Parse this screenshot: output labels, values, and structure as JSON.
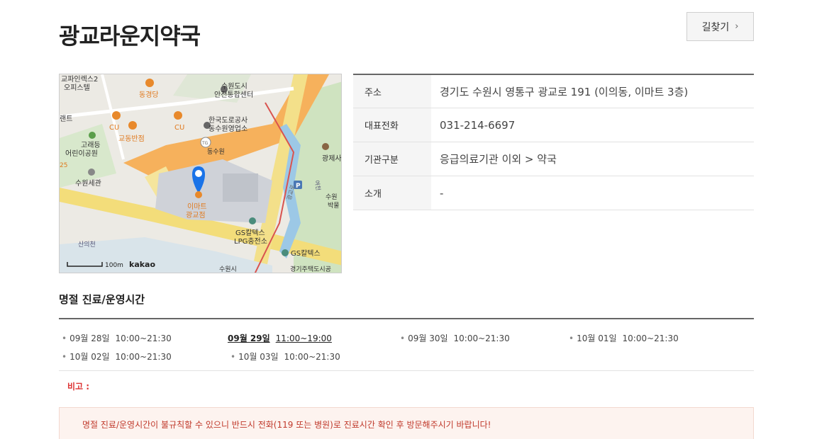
{
  "header": {
    "title": "광교라운지약국",
    "route_button_label": "길찾기",
    "route_button_icon": "chevron-right-icon"
  },
  "map": {
    "labels": {
      "l1": "교파인렉스2",
      "l2": "오피스텔",
      "l3": "동경당",
      "l4": "수원도시",
      "l5": "안전통합센터",
      "l6": "랜트",
      "l7": "CU",
      "l8": "교동반점",
      "l9": "CU",
      "l10": "한국도로공사",
      "l11": "동수원영업소",
      "l12": "고래등",
      "l13": "어린이공원",
      "l14": "동수원",
      "l15": "광제사",
      "l16": "수원세관",
      "l17": "이마트",
      "l18": "광교점",
      "l19": "수원",
      "l20": "박물",
      "l21": "GS칼텍스",
      "l22": "LPG충전소",
      "l23": "GS칼텍스",
      "l24": "산의천",
      "l25": "수원시",
      "l26": "경기주택도시공",
      "l27": "TG",
      "l28": "25",
      "l29": "광교로",
      "l30": "여천"
    },
    "scale_label": "100m",
    "provider": "kakao"
  },
  "info": {
    "rows": [
      {
        "label": "주소",
        "value": "경기도 수원시 영통구 광교로 191 (이의동, 이마트 3층)"
      },
      {
        "label": "대표전화",
        "value": "031-214-6697"
      },
      {
        "label": "기관구분",
        "value": "응급의료기관 이외 > 약국"
      },
      {
        "label": "소개",
        "value": "-"
      }
    ]
  },
  "holiday": {
    "section_title": "명절 진료/운영시간",
    "items": [
      {
        "date": "09월 28일",
        "time": "10:00~21:30"
      },
      {
        "date": "09월 29일",
        "time": "11:00~19:00"
      },
      {
        "date": "09월 30일",
        "time": "10:00~21:30"
      },
      {
        "date": "10월 01일",
        "time": "10:00~21:30"
      },
      {
        "date": "10월 02일",
        "time": "10:00~21:30"
      },
      {
        "date": "10월 03일",
        "time": "10:00~21:30"
      }
    ],
    "note_label": "비고 :",
    "notice": "명절 진료/운영시간이 불규칙할 수 있으니 반드시 전화(119 또는 병원)로 진료시간 확인 후 방문해주시기 바랍니다!"
  },
  "colors": {
    "note_red": "#dd3333",
    "notice_bg": "#fdf3ef",
    "notice_text": "#c0392b",
    "marker_blue": "#1a73e8",
    "poi_orange": "#e8892b"
  }
}
